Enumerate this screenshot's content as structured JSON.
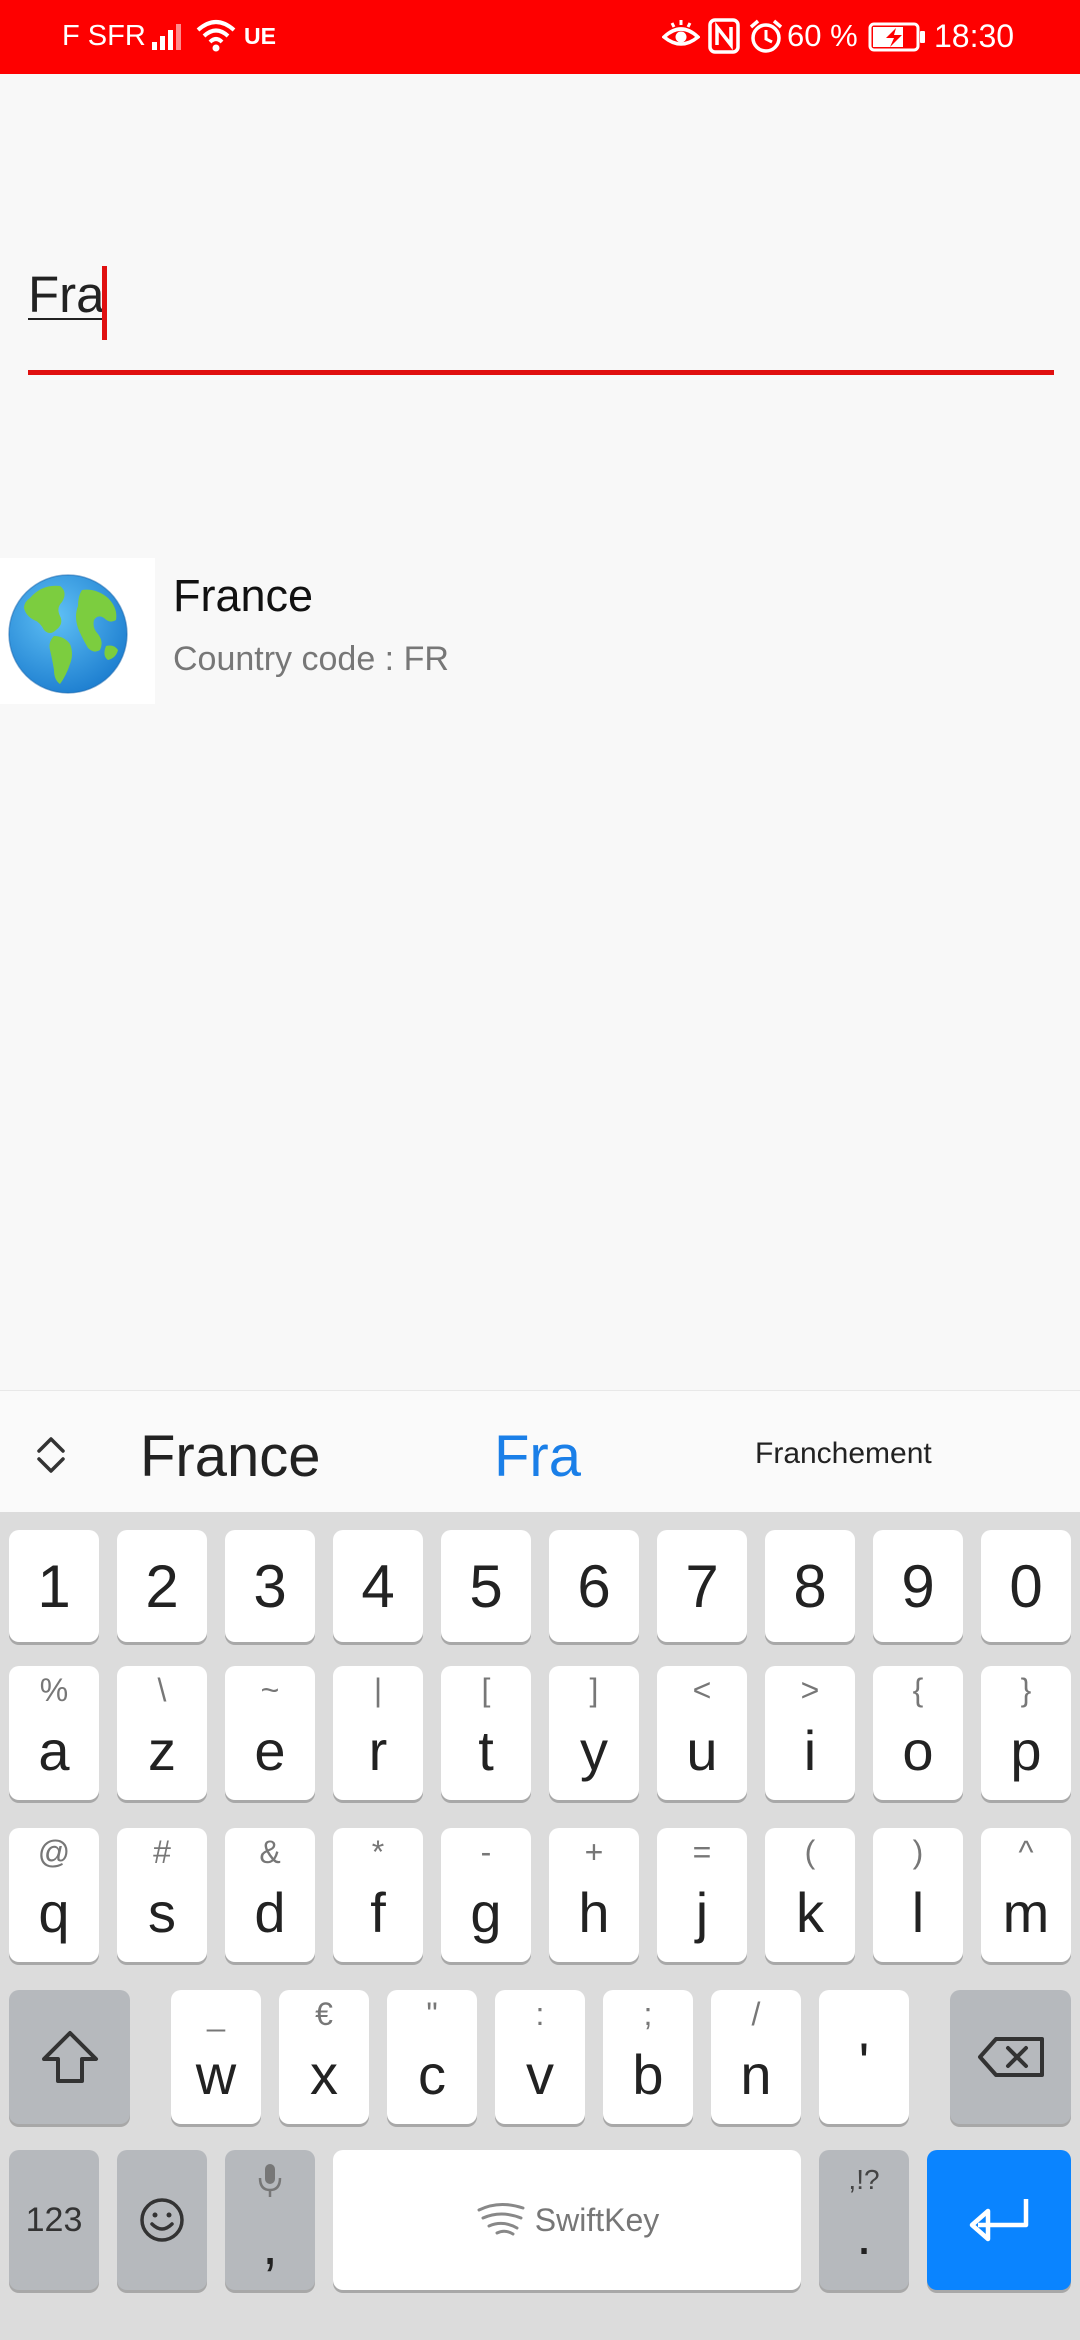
{
  "status_bar": {
    "carrier": "F SFR",
    "network": "UE",
    "battery_percent": "60 %",
    "time": "18:30",
    "icons": [
      "signal-icon",
      "wifi-icon",
      "eye-icon",
      "nfc-icon",
      "alarm-icon",
      "battery-charging-icon"
    ],
    "background_color": "#fe0000"
  },
  "search": {
    "value": "Fra",
    "accent_color": "#e01010"
  },
  "results": [
    {
      "icon": "globe-icon",
      "title": "France",
      "subtitle": "Country code : FR"
    }
  ],
  "keyboard": {
    "suggestions": [
      "France",
      "Fra",
      "Franchement"
    ],
    "number_row": [
      "1",
      "2",
      "3",
      "4",
      "5",
      "6",
      "7",
      "8",
      "9",
      "0"
    ],
    "row1": [
      {
        "main": "a",
        "alt": "%"
      },
      {
        "main": "z",
        "alt": "\\"
      },
      {
        "main": "e",
        "alt": "~"
      },
      {
        "main": "r",
        "alt": "|"
      },
      {
        "main": "t",
        "alt": "["
      },
      {
        "main": "y",
        "alt": "]"
      },
      {
        "main": "u",
        "alt": "<"
      },
      {
        "main": "i",
        "alt": ">"
      },
      {
        "main": "o",
        "alt": "{"
      },
      {
        "main": "p",
        "alt": "}"
      }
    ],
    "row2": [
      {
        "main": "q",
        "alt": "@"
      },
      {
        "main": "s",
        "alt": "#"
      },
      {
        "main": "d",
        "alt": "&"
      },
      {
        "main": "f",
        "alt": "*"
      },
      {
        "main": "g",
        "alt": "-"
      },
      {
        "main": "h",
        "alt": "+"
      },
      {
        "main": "j",
        "alt": "="
      },
      {
        "main": "k",
        "alt": "("
      },
      {
        "main": "l",
        "alt": ")"
      },
      {
        "main": "m",
        "alt": "^"
      }
    ],
    "row3": [
      {
        "main": "w",
        "alt": "_"
      },
      {
        "main": "x",
        "alt": "€"
      },
      {
        "main": "c",
        "alt": "\""
      },
      {
        "main": "v",
        "alt": ":"
      },
      {
        "main": "b",
        "alt": ";"
      },
      {
        "main": "n",
        "alt": "/"
      },
      {
        "main": "'",
        "alt": ""
      }
    ],
    "numbers_key": "123",
    "comma_key": ",",
    "space_label": "SwiftKey",
    "period_key": ".",
    "period_alt": ",!?",
    "enter_color": "#0a84ff"
  }
}
